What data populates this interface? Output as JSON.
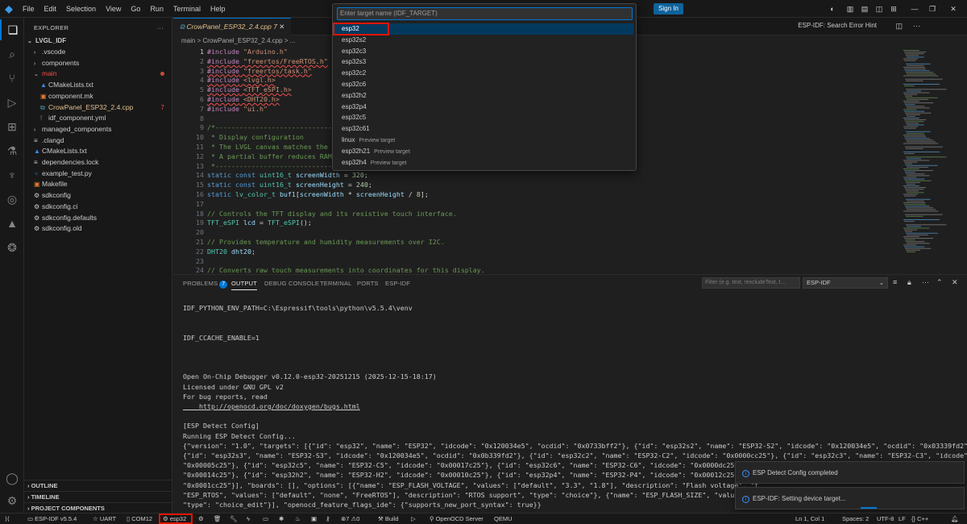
{
  "menu": [
    "File",
    "Edit",
    "Selection",
    "View",
    "Go",
    "Run",
    "Terminal",
    "Help"
  ],
  "titlebar": {
    "sign_in": "Sign In",
    "search_hint": "ESP-IDF: Search Error Hint"
  },
  "quickpick": {
    "placeholder": "Enter target name (IDF_TARGET)",
    "items": [
      {
        "label": "esp32",
        "desc": ""
      },
      {
        "label": "esp32s2",
        "desc": ""
      },
      {
        "label": "esp32c3",
        "desc": ""
      },
      {
        "label": "esp32s3",
        "desc": ""
      },
      {
        "label": "esp32c2",
        "desc": ""
      },
      {
        "label": "esp32c6",
        "desc": ""
      },
      {
        "label": "esp32h2",
        "desc": ""
      },
      {
        "label": "esp32p4",
        "desc": ""
      },
      {
        "label": "esp32c5",
        "desc": ""
      },
      {
        "label": "esp32c61",
        "desc": ""
      },
      {
        "label": "linux",
        "desc": "Preview target"
      },
      {
        "label": "esp32h21",
        "desc": "Preview target"
      },
      {
        "label": "esp32h4",
        "desc": "Preview target"
      }
    ]
  },
  "sidebar": {
    "title": "EXPLORER",
    "root": "LVGL_IDF",
    "tree": [
      {
        "label": ".vscode",
        "kind": "folder",
        "depth": 1,
        "open": false
      },
      {
        "label": "components",
        "kind": "folder",
        "depth": 1,
        "open": false
      },
      {
        "label": "main",
        "kind": "folder",
        "depth": 1,
        "open": true,
        "modified": true
      },
      {
        "label": "CMakeLists.txt",
        "kind": "cmake",
        "depth": 2
      },
      {
        "label": "component.mk",
        "kind": "mk",
        "depth": 2
      },
      {
        "label": "CrowPanel_ESP32_2.4.cpp",
        "kind": "cpp",
        "depth": 2,
        "errors": "7"
      },
      {
        "label": "idf_component.yml",
        "kind": "yml",
        "depth": 2
      },
      {
        "label": "managed_components",
        "kind": "folder",
        "depth": 1,
        "open": false
      },
      {
        "label": ".clangd",
        "kind": "file",
        "depth": 1
      },
      {
        "label": "CMakeLists.txt",
        "kind": "cmake",
        "depth": 1
      },
      {
        "label": "dependencies.lock",
        "kind": "file",
        "depth": 1
      },
      {
        "label": "example_test.py",
        "kind": "py",
        "depth": 1
      },
      {
        "label": "Makefile",
        "kind": "mk",
        "depth": 1
      },
      {
        "label": "sdkconfig",
        "kind": "gear",
        "depth": 1
      },
      {
        "label": "sdkconfig.ci",
        "kind": "gear",
        "depth": 1
      },
      {
        "label": "sdkconfig.defaults",
        "kind": "gear",
        "depth": 1
      },
      {
        "label": "sdkconfig.old",
        "kind": "gear",
        "depth": 1
      }
    ],
    "sections": [
      "OUTLINE",
      "TIMELINE",
      "PROJECT COMPONENTS"
    ]
  },
  "editor": {
    "tab_label": "CrowPanel_ESP32_2.4.cpp",
    "tab_errors": "7",
    "breadcrumb": "main  >  CrowPanel_ESP32_2.4.cpp  >  ...",
    "lines": [
      "#include \"Arduino.h\"",
      "#include \"freertos/FreeRTOS.h\"",
      "#include \"freertos/task.h\"",
      "#include <lvgl.h>",
      "#include <TFT_eSPI.h>",
      "#include <DHT20.h>",
      "#include \"ui.h\"",
      "",
      "/*-----------------------------",
      " * Display configuration",
      " * The LVGL canvas matches the p",
      " * A partial buffer reduces RAM",
      " *-----------------------------",
      "static const uint16_t screenWidth = 320;",
      "static const uint16_t screenHeight = 240;",
      "static lv_color_t buf1[screenWidth * screenHeight / 8];",
      "",
      "// Controls the TFT display and its resistive touch interface.",
      "TFT_eSPI lcd = TFT_eSPI();",
      "",
      "// Provides temperature and humidity measurements over I2C.",
      "DHT20 dht20;",
      "",
      "// Converts raw touch measurements into coordinates for this display."
    ]
  },
  "panel": {
    "tabs": [
      "PROBLEMS",
      "OUTPUT",
      "DEBUG CONSOLE",
      "TERMINAL",
      "PORTS",
      "ESP-IDF"
    ],
    "problems_count": "7",
    "filter_placeholder": "Filter (e.g. text, !excludeText, t...",
    "channel": "ESP-IDF",
    "output": [
      "IDF_PYTHON_ENV_PATH=C:\\Espressif\\tools\\python\\v5.5.4\\venv",
      "",
      "",
      "IDF_CCACHE_ENABLE=1",
      "",
      "",
      "",
      "Open On-Chip Debugger v0.12.0-esp32-20251215 (2025-12-15-18:17)",
      "Licensed under GNU GPL v2",
      "For bug reports, read",
      "    http://openocd.org/doc/doxygen/bugs.html",
      "",
      "[ESP Detect Config]",
      "Running ESP Detect Config...",
      "{\"version\": \"1.0\", \"targets\": [{\"id\": \"esp32\", \"name\": \"ESP32\", \"idcode\": \"0x120034e5\", \"ocdid\": \"0x0733bff2\"}, {\"id\": \"esp32s2\", \"name\": \"ESP32-S2\", \"idcode\": \"0x120034e5\", \"ocdid\": \"0x03339fd2\"},",
      "{\"id\": \"esp32s3\", \"name\": \"ESP32-S3\", \"idcode\": \"0x120034e5\", \"ocdid\": \"0x0b339fd2\"}, {\"id\": \"esp32c2\", \"name\": \"ESP32-C2\", \"idcode\": \"0x0000cc25\"}, {\"id\": \"esp32c3\", \"name\": \"ESP32-C3\", \"idcode\":",
      "\"0x00005c25\"}, {\"id\": \"esp32c5\", \"name\": \"ESP32-C5\", \"idcode\": \"0x00017c25\"}, {\"id\": \"esp32c6\", \"name\": \"ESP32-C6\", \"idcode\": \"0x0000dc25\"}, {\"id\": \"esp32c61\", \"name\": \"ESP32-C61\", \"idcode\":",
      "\"0x00014c25\"}, {\"id\": \"esp32h2\", \"name\": \"ESP32-H2\", \"idcode\": \"0x00010c25\"}, {\"id\": \"esp32p4\", \"name\": \"ESP32-P4\", \"idcode\": \"0x00012c25\"}, {\"id\": \"esp32h4\", \"name\": \"ESP32-H4\", \"idcode\":",
      "\"0x0001cc25\"}], \"boards\": [], \"options\": [{\"name\": \"ESP_FLASH_VOLTAGE\", \"values\": [\"default\", \"3.3\", \"1.8\"], \"description\": \"Flash voltage\", \"t",
      "\"ESP_RTOS\", \"values\": [\"default\", \"none\", \"FreeRTOS\"], \"description\": \"RTOS support\", \"type\": \"choice\"}, {\"name\": \"ESP_FLASH_SIZE\", \"values\": [",
      "\"type\": \"choice_edit\"}], \"openocd_feature_flags_ide\": {\"supports_new_port_syntax\": true}}"
    ]
  },
  "notifications": [
    "ESP Detect Config completed",
    "ESP-IDF: Setting device target..."
  ],
  "statusbar": {
    "idf_version": "ESP-IDF v5.5.4",
    "uart": "UART",
    "port": "COM12",
    "target": "esp32",
    "problems": "7",
    "warnings": "0",
    "build": "Build",
    "openocd": "OpenOCD Server",
    "qemu": "QEMU",
    "position": "Ln 1, Col 1",
    "spaces": "Spaces: 2",
    "encoding": "UTF-8",
    "eol": "LF",
    "language": "C++"
  },
  "colors": {
    "accent": "#0078d4",
    "highlight_box": "#e51400",
    "selected_item": "#04395e"
  }
}
